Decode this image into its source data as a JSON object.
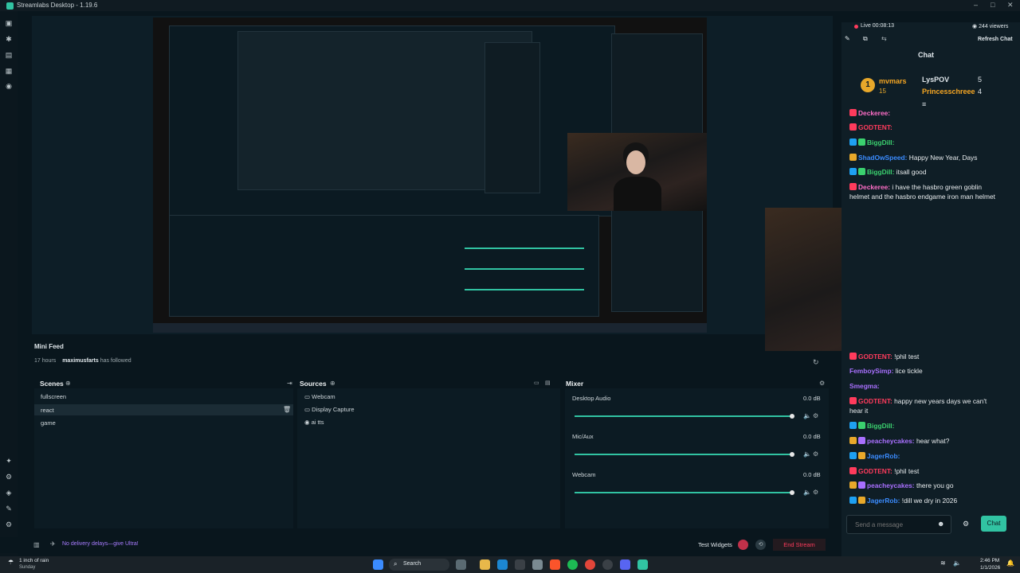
{
  "window": {
    "title": "Streamlabs Desktop - 1.19.6"
  },
  "stream_status": {
    "live_time": "Live 00:08:13",
    "viewers": "244 viewers",
    "refresh_label": "Refresh Chat"
  },
  "chat": {
    "title": "Chat",
    "top": {
      "rank1": {
        "name": "mvmars",
        "count": "15"
      },
      "rank2": {
        "name": "LysPOV",
        "count": "5"
      },
      "rank3": {
        "name": "Princesschreee",
        "count": "4"
      }
    },
    "messages_top": [
      {
        "name": "Deckeree:",
        "text": "",
        "color": "#ff6ec7"
      },
      {
        "name": "GODTENT:",
        "text": "",
        "color": "#ff3b5c"
      },
      {
        "name": "BiggDill:",
        "text": "",
        "color": "#3bd16f"
      },
      {
        "name": "ShadOwSpeed:",
        "text": "Happy New Year, Days",
        "color": "#3b8cff"
      },
      {
        "name": "BiggDill:",
        "text": "itsall good",
        "color": "#3bd16f"
      },
      {
        "name": "Deckeree:",
        "text": "i have the hasbro green goblin",
        "color": "#ff6ec7"
      },
      {
        "name": "",
        "text": "helmet and the hasbro endgame iron man helmet",
        "color": "#ffffff"
      }
    ],
    "messages_bottom": [
      {
        "name": "GODTENT:",
        "text": "!phil test",
        "color": "#ff3b5c"
      },
      {
        "name": "FemboySimp:",
        "text": "lice tickle",
        "color": "#a970ff"
      },
      {
        "name": "Smegma:",
        "text": "",
        "color": "#a970ff"
      },
      {
        "name": "GODTENT:",
        "text": "happy new years days we can't",
        "color": "#ff3b5c"
      },
      {
        "name": "",
        "text": "hear it",
        "color": "#ffffff"
      },
      {
        "name": "BiggDill:",
        "text": "",
        "color": "#3bd16f"
      },
      {
        "name": "peacheycakes:",
        "text": "hear what?",
        "color": "#a970ff"
      },
      {
        "name": "JagerRob:",
        "text": "",
        "color": "#3b8cff"
      },
      {
        "name": "GODTENT:",
        "text": "!phil test",
        "color": "#ff3b5c"
      },
      {
        "name": "peacheycakes:",
        "text": "there you go",
        "color": "#a970ff"
      },
      {
        "name": "JagerRob:",
        "text": "!dill we dry in 2026",
        "color": "#3b8cff"
      }
    ],
    "input_placeholder": "Send a message",
    "send_label": "Chat"
  },
  "mini_feed": {
    "title": "Mini Feed",
    "time": "17 hours",
    "user": "maximusfarts",
    "event": "has followed"
  },
  "scenes": {
    "title": "Scenes",
    "items": [
      "fullscreen",
      "react",
      "game"
    ]
  },
  "sources": {
    "title": "Sources",
    "items": [
      "Webcam",
      "Display Capture",
      "ai tts"
    ]
  },
  "mixer": {
    "title": "Mixer",
    "channels": [
      {
        "name": "Desktop Audio",
        "db": "0.0 dB",
        "level": 0.99
      },
      {
        "name": "Mic/Aux",
        "db": "0.0 dB",
        "level": 0.99
      },
      {
        "name": "Webcam",
        "db": "0.0 dB",
        "level": 0.99
      }
    ]
  },
  "footer": {
    "promo": "No delivery delays—give Ultra!",
    "test_widgets": "Test Widgets",
    "end_stream": "End Stream"
  },
  "taskbar": {
    "weather": "1 inch of rain",
    "weather_sub": "Sunday",
    "search": "Search",
    "time": "2:46 PM",
    "date": "1/1/2026"
  },
  "colors": {
    "accent": "#31c3a2",
    "end_stream": "#ff3b5c",
    "bg": "#09161d"
  }
}
